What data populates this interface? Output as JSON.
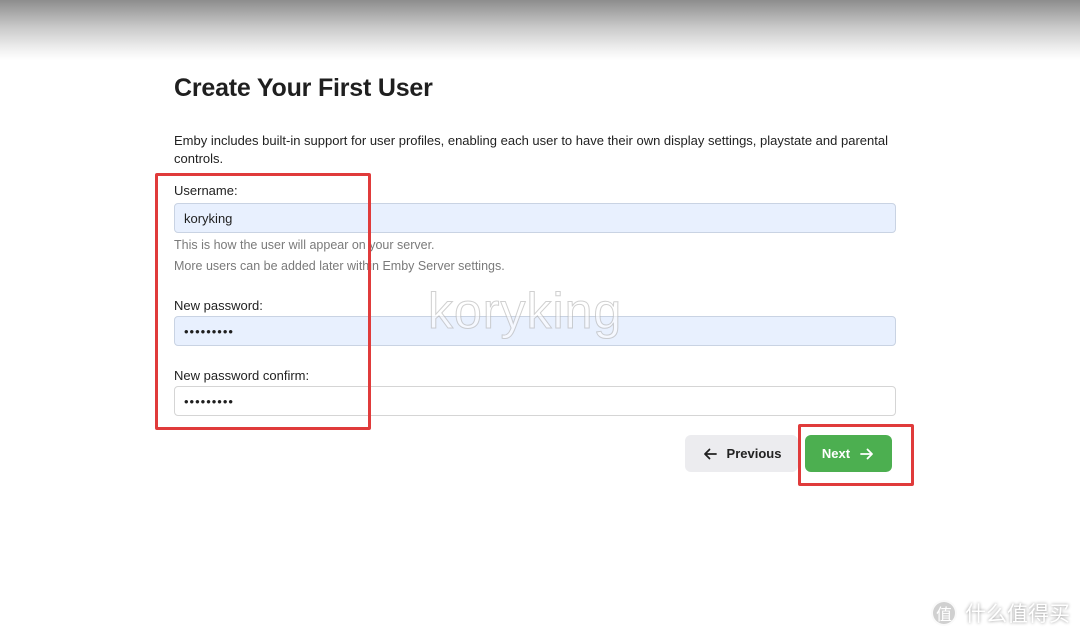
{
  "page": {
    "title": "Create Your First User",
    "intro": "Emby includes built-in support for user profiles, enabling each user to have their own display settings, playstate and parental controls."
  },
  "form": {
    "username_label": "Username:",
    "username_value": "koryking",
    "username_help_1": "This is how the user will appear on your server.",
    "username_help_2": "More users can be added later within Emby Server settings.",
    "password_label": "New password:",
    "password_value": "•••••••••",
    "password_confirm_label": "New password confirm:",
    "password_confirm_value": "•••••••••"
  },
  "buttons": {
    "previous_label": "Previous",
    "previous_icon": "arrow-left-icon",
    "next_label": "Next",
    "next_icon": "arrow-right-icon"
  },
  "overlay": {
    "watermark": "koryking",
    "brand_logo_glyph": "值",
    "brand_text": "什么值得买",
    "annotation_color": "#e03b3b"
  },
  "colors": {
    "next_button": "#4caf50",
    "autofill_background": "#e8f0fe"
  }
}
